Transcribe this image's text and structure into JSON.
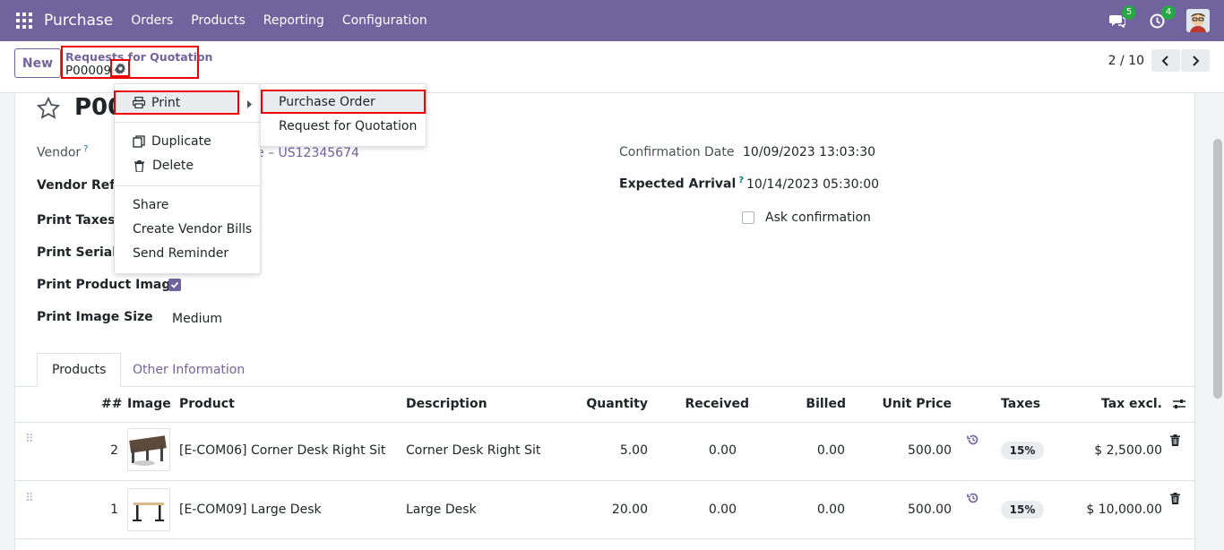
{
  "navbar": {
    "app_name": "Purchase",
    "menu": [
      "Orders",
      "Products",
      "Reporting",
      "Configuration"
    ],
    "messages_count": "5",
    "activities_count": "4"
  },
  "control": {
    "new_label": "New",
    "breadcrumb_parent": "Requests for Quotation",
    "breadcrumb_current": "P00009",
    "pager": "2 / 10"
  },
  "record": {
    "name": "P00",
    "vendor_label": "Vendor",
    "vendor_value_partial": "e – US12345674",
    "vendor_ref_label": "Vendor Refer",
    "print_taxes_label": "Print Taxes",
    "print_serial_label": "Print Serial N",
    "print_product_image_label": "Print Product Image",
    "print_image_size_label": "Print Image Size",
    "print_image_size_value": "Medium",
    "confirmation_date_label": "Confirmation Date",
    "confirmation_date_value": "10/09/2023 13:03:30",
    "expected_arrival_label": "Expected Arrival",
    "expected_arrival_value": "10/14/2023 05:30:00",
    "ask_confirmation_label": "Ask confirmation"
  },
  "tabs": [
    "Products",
    "Other Information"
  ],
  "table": {
    "headers": [
      "##",
      "Image",
      "Product",
      "Description",
      "Quantity",
      "Received",
      "Billed",
      "Unit Price",
      "Taxes",
      "Tax excl."
    ],
    "rows": [
      {
        "seq": "2",
        "product": "[E-COM06] Corner Desk Right Sit",
        "description": "Corner Desk Right Sit",
        "quantity": "5.00",
        "received": "0.00",
        "billed": "0.00",
        "unit_price": "500.00",
        "taxes": "15%",
        "subtotal": "$ 2,500.00"
      },
      {
        "seq": "1",
        "product": "[E-COM09] Large Desk",
        "description": "Large Desk",
        "quantity": "20.00",
        "received": "0.00",
        "billed": "0.00",
        "unit_price": "500.00",
        "taxes": "15%",
        "subtotal": "$ 10,000.00"
      }
    ]
  },
  "action_menu": {
    "print": "Print",
    "duplicate": "Duplicate",
    "delete": "Delete",
    "share": "Share",
    "create_vendor_bills": "Create Vendor Bills",
    "send_reminder": "Send Reminder"
  },
  "print_submenu": [
    "Purchase Order",
    "Request for Quotation"
  ],
  "colors": {
    "brand": "#71639e",
    "highlight": "#e00000",
    "badge": "#28a745"
  }
}
